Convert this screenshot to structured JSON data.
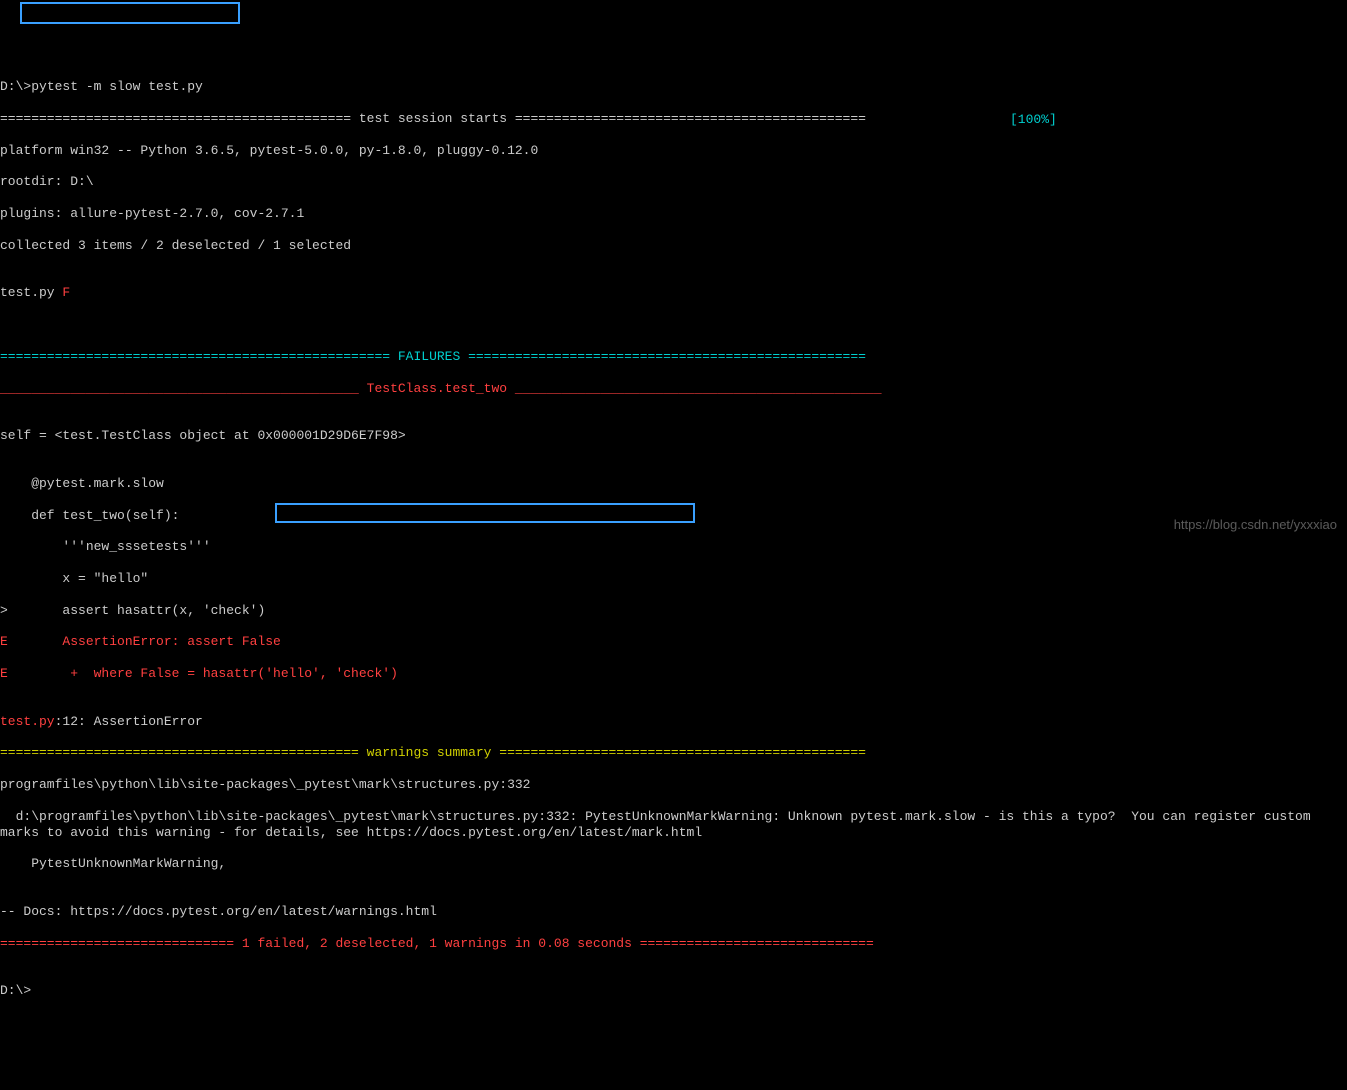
{
  "prompt": {
    "cwd": "D:\\>",
    "command": "pytest -m slow test.py"
  },
  "session_start_header": "============================================= test session starts =============================================",
  "platform_line": "platform win32 -- Python 3.6.5, pytest-5.0.0, py-1.8.0, pluggy-0.12.0",
  "rootdir_line": "rootdir: D:\\",
  "plugins_line": "plugins: allure-pytest-2.7.0, cov-2.7.1",
  "collected_line": "collected 3 items / 2 deselected / 1 selected",
  "blank": "",
  "test_result": {
    "file": "test.py ",
    "status": "F",
    "progress": "[100%]"
  },
  "failures_header": "================================================== FAILURES ===================================================",
  "test_name_line": "______________________________________________ TestClass.test_two _______________________________________________",
  "self_line": "self = <test.TestClass object at 0x000001D29D6E7F98>",
  "code_lines": {
    "decorator": "    @pytest.mark.slow",
    "def": "    def test_two(self):",
    "doc": "        '''new_sssetests'''",
    "x": "        x = \"hello\"",
    "assert": ">       assert hasattr(x, 'check')",
    "e1": "E       AssertionError: assert False",
    "e2": "E        +  where False = hasattr('hello', 'check')"
  },
  "traceback_loc_prefix": "test.py",
  "traceback_loc_suffix": ":12: AssertionError",
  "warnings_header": "============================================== warnings summary ===============================================",
  "warn_line1": "programfiles\\python\\lib\\site-packages\\_pytest\\mark\\structures.py:332",
  "warn_line2": "  d:\\programfiles\\python\\lib\\site-packages\\_pytest\\mark\\structures.py:332: PytestUnknownMarkWarning: Unknown pytest.mark.slow - is this a typo?  You can register custom marks to avoid this warning - for details, see https://docs.pytest.org/en/latest/mark.html",
  "warn_line3": "    PytestUnknownMarkWarning,",
  "docs_line": "-- Docs: https://docs.pytest.org/en/latest/warnings.html",
  "summary_line": "============================== 1 failed, 2 deselected, 1 warnings in 0.08 seconds ==============================",
  "final_prompt": "D:\\>",
  "watermark": "https://blog.csdn.net/yxxxiao"
}
